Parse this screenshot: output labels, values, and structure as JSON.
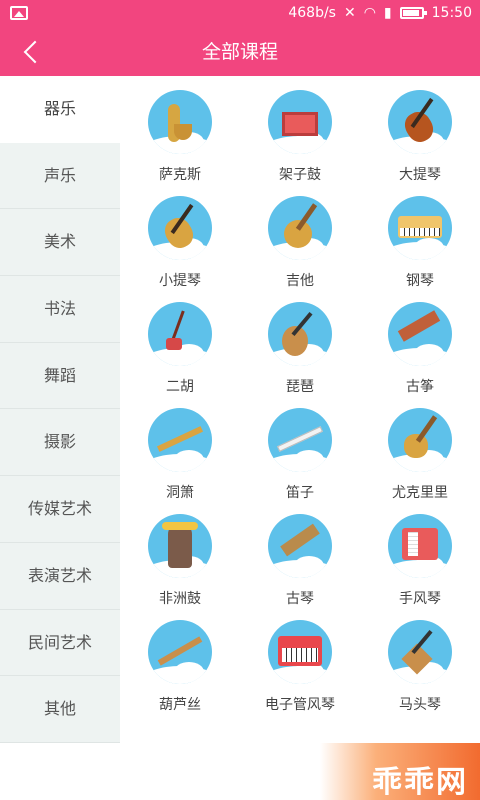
{
  "status_bar": {
    "speed": "468b/s",
    "time": "15:50"
  },
  "header": {
    "title": "全部课程"
  },
  "sidebar": {
    "items": [
      {
        "label": "器乐",
        "active": true
      },
      {
        "label": "声乐"
      },
      {
        "label": "美术"
      },
      {
        "label": "书法"
      },
      {
        "label": "舞蹈"
      },
      {
        "label": "摄影"
      },
      {
        "label": "传媒艺术"
      },
      {
        "label": "表演艺术"
      },
      {
        "label": "民间艺术"
      },
      {
        "label": "其他"
      }
    ]
  },
  "grid": {
    "items": [
      {
        "label": "萨克斯",
        "icon": "saxophone-icon"
      },
      {
        "label": "架子鼓",
        "icon": "drum-kit-icon"
      },
      {
        "label": "大提琴",
        "icon": "cello-icon"
      },
      {
        "label": "小提琴",
        "icon": "violin-icon"
      },
      {
        "label": "吉他",
        "icon": "guitar-icon"
      },
      {
        "label": "钢琴",
        "icon": "piano-icon"
      },
      {
        "label": "二胡",
        "icon": "erhu-icon"
      },
      {
        "label": "琵琶",
        "icon": "pipa-icon"
      },
      {
        "label": "古筝",
        "icon": "guzheng-icon"
      },
      {
        "label": "洞箫",
        "icon": "dongxiao-icon"
      },
      {
        "label": "笛子",
        "icon": "flute-icon"
      },
      {
        "label": "尤克里里",
        "icon": "ukulele-icon"
      },
      {
        "label": "非洲鼓",
        "icon": "djembe-icon"
      },
      {
        "label": "古琴",
        "icon": "guqin-icon"
      },
      {
        "label": "手风琴",
        "icon": "accordion-icon"
      },
      {
        "label": "葫芦丝",
        "icon": "hulusi-icon"
      },
      {
        "label": "电子管风琴",
        "icon": "electronic-organ-icon"
      },
      {
        "label": "马头琴",
        "icon": "morin-khuur-icon"
      }
    ]
  },
  "watermark": {
    "text": "乖乖网"
  },
  "colors": {
    "brand_pink": "#f2457f",
    "circle_blue": "#5ec1ea",
    "sidebar_bg": "#eef3f2"
  }
}
